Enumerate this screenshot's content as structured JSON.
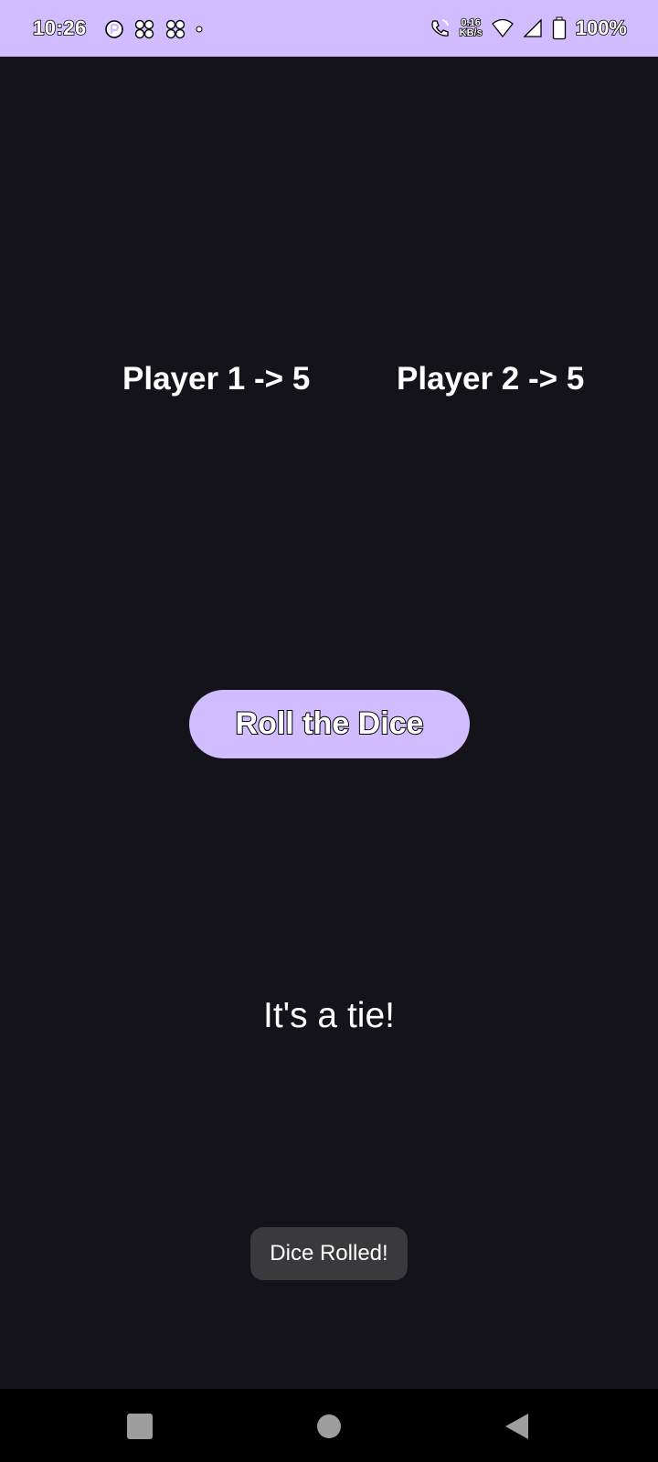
{
  "status_bar": {
    "time": "10:26",
    "left_icons": [
      "app-notification-icon",
      "pinwheel-icon",
      "pinwheel-icon",
      "dot-icon"
    ],
    "speed_value": "0.16",
    "speed_unit": "KB/s",
    "battery": "100%",
    "background_color": "#d0bcfe"
  },
  "game": {
    "player1_score": "Player 1 -> 5",
    "player2_score": "Player 2 -> 5",
    "roll_button_label": "Roll the Dice",
    "result": "It's a tie!"
  },
  "toast": {
    "message": "Dice Rolled!"
  },
  "nav_bar": {
    "buttons": [
      "recents-icon",
      "home-icon",
      "back-icon"
    ]
  },
  "colors": {
    "background": "#15131a",
    "accent": "#d0bcfe",
    "toast": "#3a3a3c"
  }
}
